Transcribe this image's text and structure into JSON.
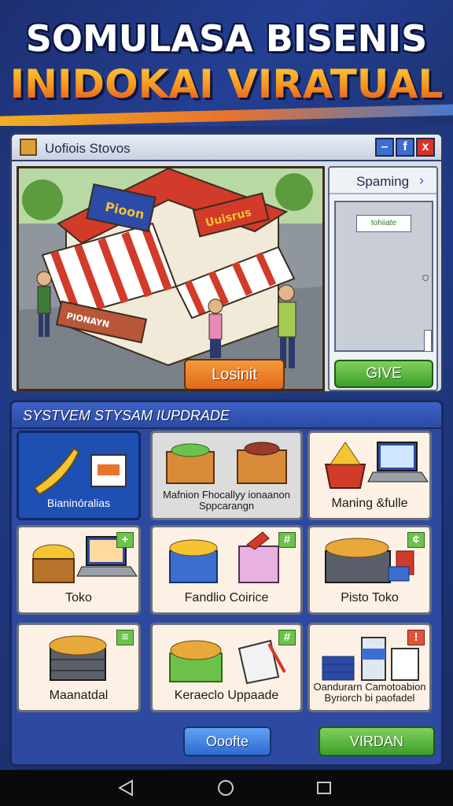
{
  "title": {
    "line1": "SOMULASA BISENIS",
    "line2": "INIDOKAI VIRATUAL"
  },
  "store_window": {
    "title": "Uofiois Stovos",
    "controls": {
      "minimize": "–",
      "maximize": "f",
      "close": "x"
    },
    "scene": {
      "sign_left": "Pioon",
      "sign_right": "Uuisrus",
      "planter_text": "PIONAYN",
      "lost_button": "Losinit"
    },
    "side_panel": {
      "title": "Spaming",
      "tag": "tohiiate",
      "give_button": "GIVE"
    }
  },
  "upgrade_panel": {
    "title": "SYSTVEM STYSAM IUPDRADE",
    "cards": [
      {
        "label": "Bianinóralias",
        "selected": true,
        "badge": ""
      },
      {
        "label": "Mafnion Fhocallyy ionaanon Sppcarangn",
        "selected": false,
        "badge": ""
      },
      {
        "label": "Maning &fulle",
        "selected": false,
        "badge": ""
      },
      {
        "label": "Toko",
        "selected": false,
        "badge": "+"
      },
      {
        "label": "Fandlio Coirice",
        "selected": false,
        "badge": "#"
      },
      {
        "label": "Pisto Toko",
        "selected": false,
        "badge": "¢"
      },
      {
        "label": "Maanatdal",
        "selected": false,
        "badge": "≡"
      },
      {
        "label": "Keraeclo Uppaade",
        "selected": false,
        "badge": "#"
      },
      {
        "label": "Oandurarn Camotoabion Byriorch bi paofadel",
        "selected": false,
        "badge": "!"
      }
    ],
    "buttons": {
      "left": "Ooofte",
      "right": "VIRDAN"
    }
  },
  "colors": {
    "accent_blue": "#2f6ad0",
    "accent_green": "#3e9d2c",
    "accent_orange": "#e06a1d",
    "title_orange": "#f5a623"
  }
}
